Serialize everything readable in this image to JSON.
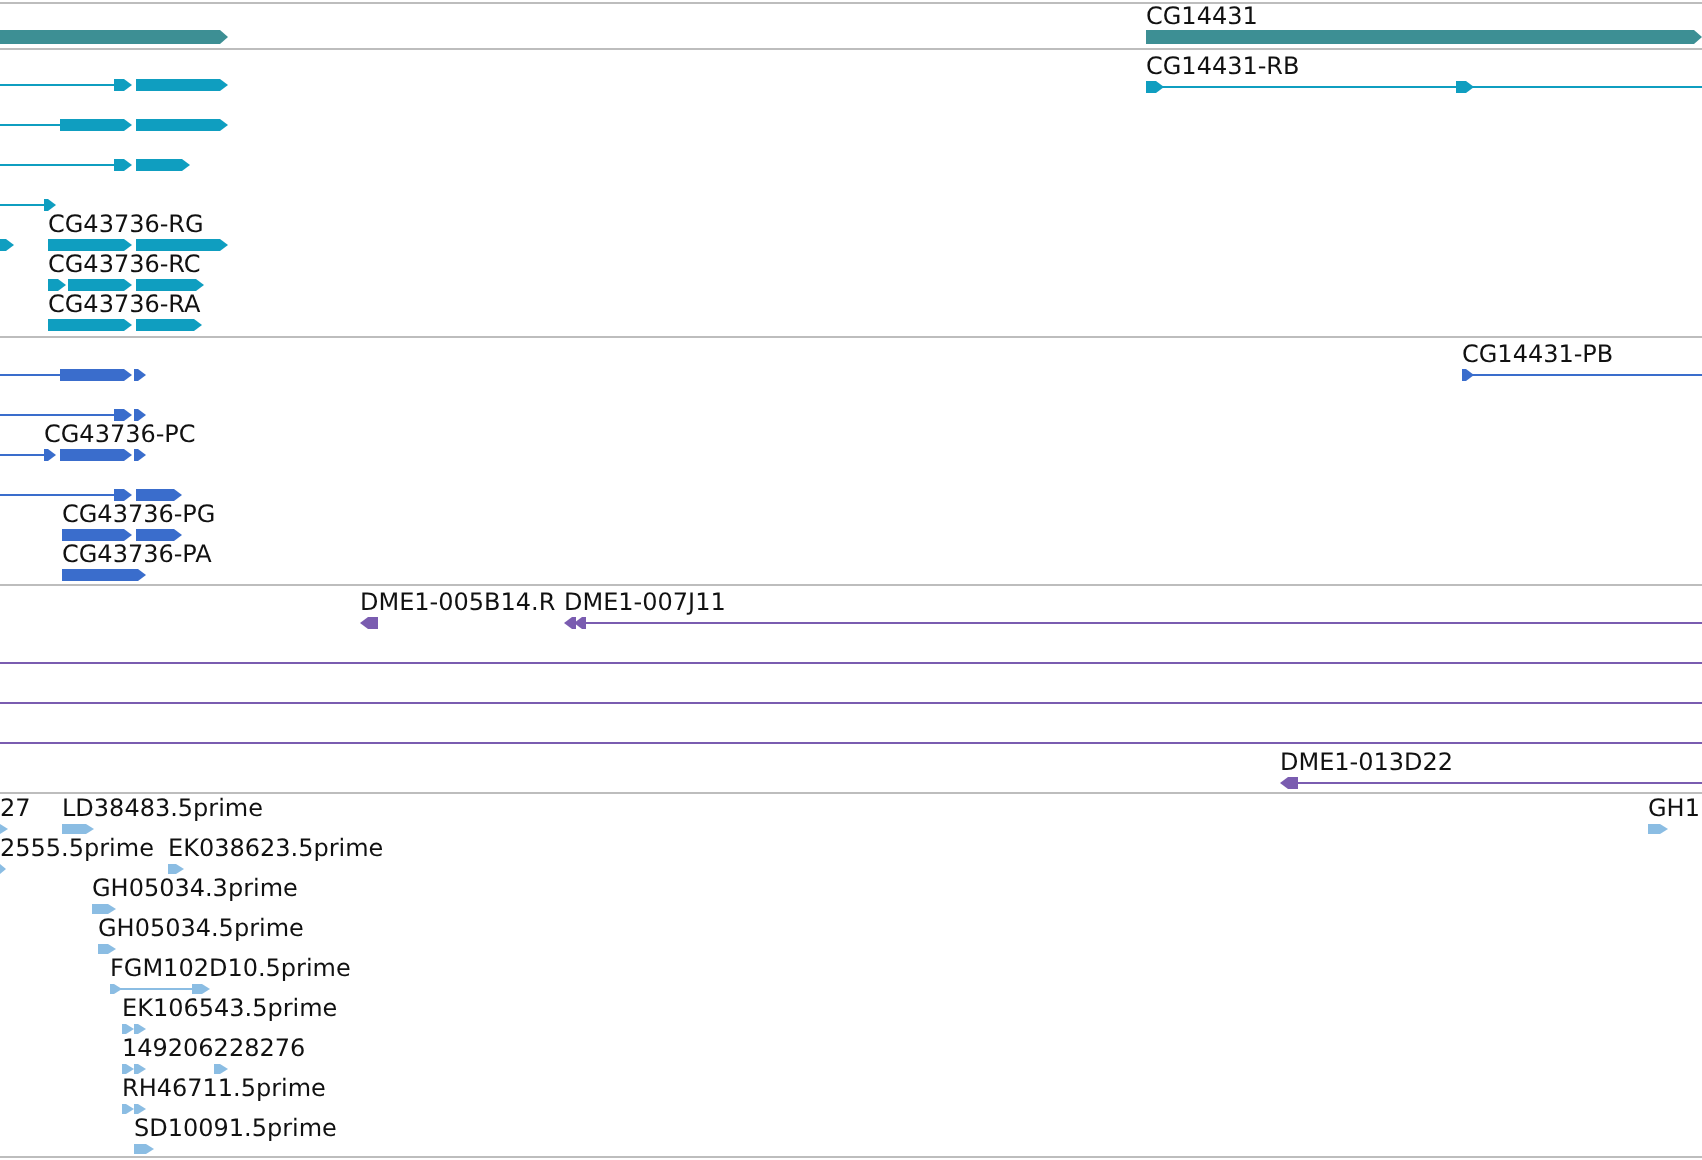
{
  "tracks": [
    {
      "kind": "gene",
      "features": [
        {
          "reverse": false
        },
        {
          "label": "CG14431",
          "reverse": false
        }
      ]
    },
    {
      "kind": "transcript",
      "features": [
        {
          "reverse": false
        },
        {
          "label": "CG14431-RB",
          "reverse": false
        },
        {
          "reverse": false
        },
        {
          "reverse": false
        },
        {
          "reverse": false
        },
        {
          "reverse": false
        },
        {
          "label": "CG43736-RG",
          "reverse": false
        },
        {
          "label": "CG43736-RC",
          "reverse": false
        },
        {
          "label": "CG43736-RA",
          "reverse": false
        }
      ]
    },
    {
      "kind": "protein",
      "features": [
        {
          "reverse": false
        },
        {
          "label": "CG14431-PB",
          "reverse": false
        },
        {
          "reverse": false
        },
        {
          "label": "CG43736-PC",
          "reverse": false
        },
        {
          "reverse": false
        },
        {
          "label": "CG43736-PG",
          "reverse": false
        },
        {
          "label": "CG43736-PA",
          "reverse": false
        }
      ]
    },
    {
      "kind": "clone",
      "features": [
        {
          "kind": "arrow",
          "label": "DME1-005B14.R",
          "reverse": true
        },
        {
          "kind": "arrow",
          "label": "DME1-007J11",
          "reverse": true
        },
        {
          "kind": "line"
        },
        {
          "kind": "line"
        },
        {
          "kind": "line"
        },
        {
          "kind": "arrow",
          "label": "DME1-013D22",
          "reverse": true
        }
      ]
    },
    {
      "kind": "est",
      "features": [
        {
          "label": "27",
          "reverse": false
        },
        {
          "label": "LD38483.5prime",
          "reverse": false
        },
        {
          "label": "GH1",
          "reverse": false
        },
        {
          "label": "2555.5prime",
          "reverse": false
        },
        {
          "label": "EK038623.5prime",
          "reverse": false
        },
        {
          "label": "GH05034.3prime",
          "reverse": false
        },
        {
          "label": "GH05034.5prime",
          "reverse": false
        },
        {
          "label": "FGM102D10.5prime",
          "reverse": false
        },
        {
          "label": "EK106543.5prime",
          "reverse": false
        },
        {
          "label": "149206228276",
          "reverse": false
        },
        {
          "label": "RH46711.5prime",
          "reverse": false
        },
        {
          "label": "SD10091.5prime",
          "reverse": false
        }
      ]
    }
  ]
}
